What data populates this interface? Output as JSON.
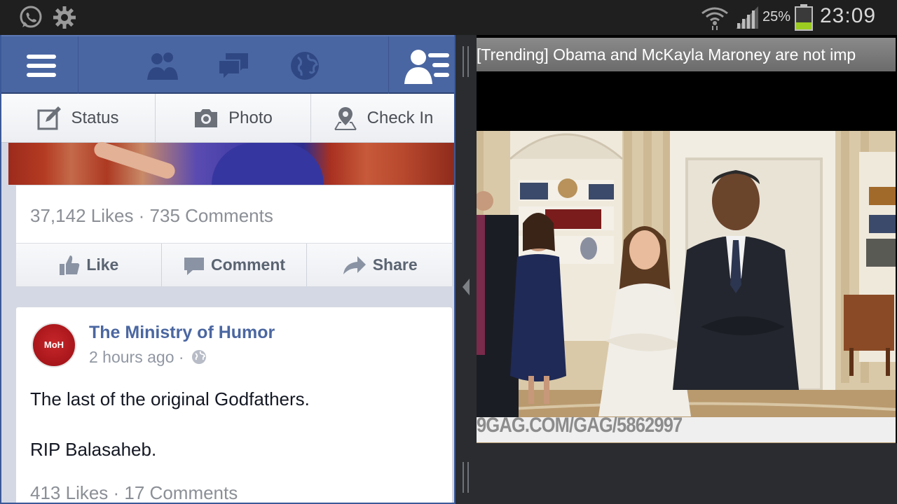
{
  "status_bar": {
    "battery_percent": "25%",
    "time": "23:09",
    "icons": [
      "whatsapp-icon",
      "settings-gear-icon",
      "wifi-icon",
      "signal-icon",
      "battery-icon"
    ]
  },
  "facebook": {
    "composer": {
      "status_label": "Status",
      "photo_label": "Photo",
      "checkin_label": "Check In"
    },
    "post1": {
      "stats": "37,142 Likes · 735 Comments",
      "like_label": "Like",
      "comment_label": "Comment",
      "share_label": "Share"
    },
    "post2": {
      "avatar_text": "MoH",
      "page_name": "The Ministry of Humor",
      "time": "2 hours ago ·",
      "text_line1": "The last of the original Godfathers.",
      "text_line2": "RIP Balasaheb.",
      "stats": "413 Likes · 17 Comments"
    },
    "colors": {
      "bar": "#4a66a2",
      "link": "#4b67a1"
    }
  },
  "right_pane": {
    "trending_title": "[Trending] Obama and McKayla Maroney are not imp",
    "watermark": "9GAG.COM/GAG/5862997"
  }
}
